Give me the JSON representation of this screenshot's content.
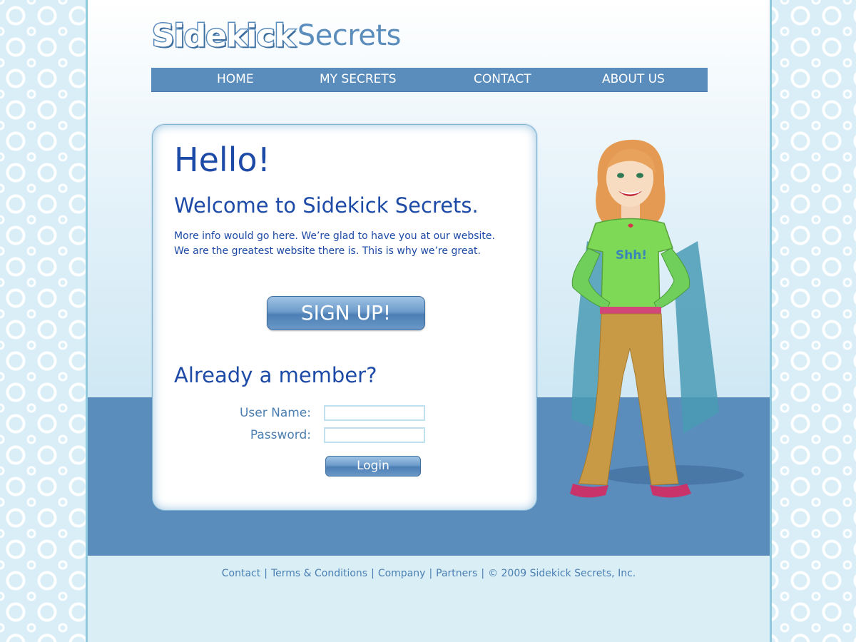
{
  "brand": {
    "logo_bold": "Sidekick",
    "logo_light": "Secrets"
  },
  "nav": {
    "items": [
      "HOME",
      "MY SECRETS",
      "CONTACT",
      "ABOUT US"
    ]
  },
  "card": {
    "greeting": "Hello!",
    "welcome": "Welcome to Sidekick Secrets.",
    "info_line1": "More info would go here.  We’re glad to have you at our website.",
    "info_line2": "We are the greatest website there is.  This is why we’re great.",
    "signup_label": "SIGN UP!",
    "member_heading": "Already a member?",
    "username_label": "User Name:",
    "username_value": "",
    "password_label": "Password:",
    "password_value": "",
    "login_label": "Login"
  },
  "illustration": {
    "shirt_text": "Shh!"
  },
  "footer": {
    "links": [
      "Contact",
      "Terms & Conditions",
      "Company",
      "Partners"
    ],
    "separator": "|",
    "copyright": "© 2009 Sidekick Secrets, Inc."
  },
  "colors": {
    "accent": "#5a8cbc",
    "heading": "#1d4aa6",
    "label": "#4b7fb2",
    "background_pattern": "#d9eef6"
  }
}
